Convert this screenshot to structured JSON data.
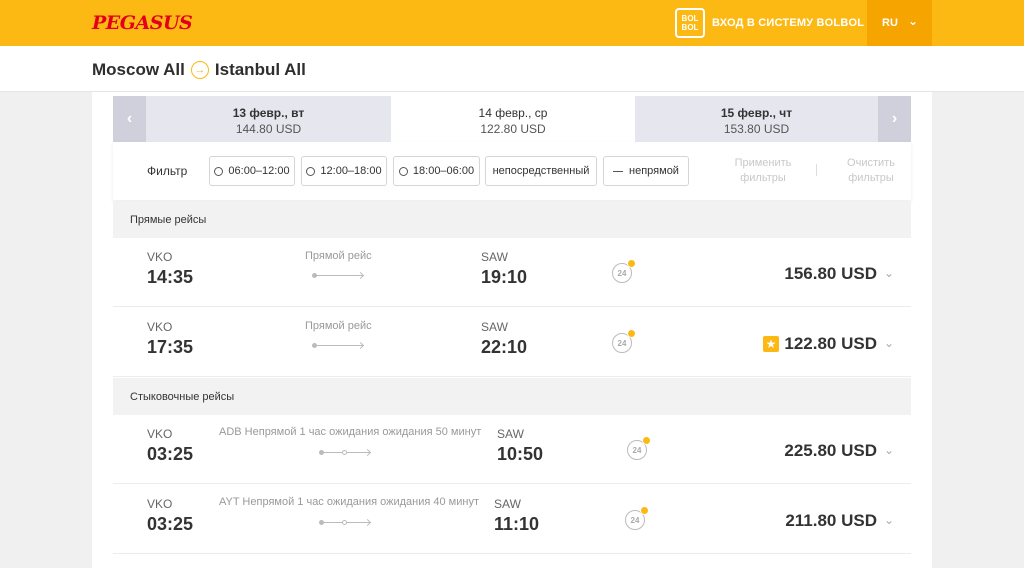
{
  "header": {
    "logo": "PEGASUS",
    "bolbol_icon": "BOL BOL",
    "login": "ВХОД В СИСТЕМУ BOLBOL",
    "lang": "RU"
  },
  "route": {
    "from": "Moscow All",
    "to": "Istanbul All"
  },
  "dates": [
    {
      "label": "13 февр., вт",
      "price": "144.80 USD"
    },
    {
      "label": "14 февр., ср",
      "price": "122.80 USD"
    },
    {
      "label": "15 февр., чт",
      "price": "153.80 USD"
    }
  ],
  "filter": {
    "label": "Фильтр",
    "options": [
      "06:00–12:00",
      "12:00–18:00",
      "18:00–06:00",
      "непосредственный",
      "непрямой"
    ],
    "apply": "Применить фильтры",
    "clear": "Очистить фильтры"
  },
  "sections": {
    "direct": "Прямые рейсы",
    "connecting": "Стыковочные рейсы"
  },
  "direct_flights": [
    {
      "dep_code": "VKO",
      "dep_time": "14:35",
      "stop": "Прямой рейс",
      "arr_code": "SAW",
      "arr_time": "19:10",
      "price": "156.80 USD"
    },
    {
      "dep_code": "VKO",
      "dep_time": "17:35",
      "stop": "Прямой рейс",
      "arr_code": "SAW",
      "arr_time": "22:10",
      "price": "122.80 USD"
    }
  ],
  "connecting_flights": [
    {
      "dep_code": "VKO",
      "dep_time": "03:25",
      "stop": "ADB Непрямой 1 час ожидания ожидания 50 минут",
      "arr_code": "SAW",
      "arr_time": "10:50",
      "price": "225.80 USD"
    },
    {
      "dep_code": "VKO",
      "dep_time": "03:25",
      "stop": "AYT Непрямой 1 час ожидания ожидания 40 минут",
      "arr_code": "SAW",
      "arr_time": "11:10",
      "price": "211.80 USD"
    }
  ],
  "icons": {
    "badge": "24",
    "star": "★",
    "chevron": "⌄"
  },
  "colors": {
    "brand": "#fdb913",
    "logo_red": "#e2001a"
  }
}
